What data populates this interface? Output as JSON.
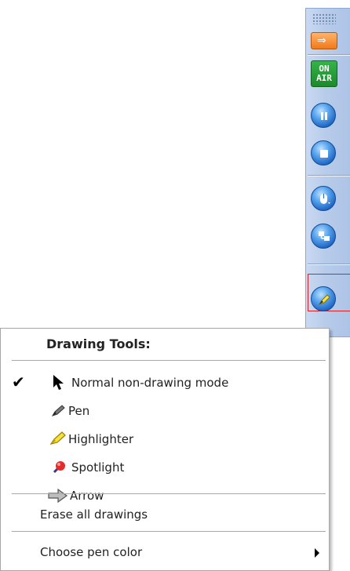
{
  "toolbar": {
    "onair_line1": "ON",
    "onair_line2": "AIR",
    "arrow_glyph": "⇒"
  },
  "menu": {
    "title": "Drawing Tools:",
    "items": [
      {
        "label": "Normal non-drawing mode",
        "checked": true,
        "icon": "cursor-icon"
      },
      {
        "label": "Pen",
        "icon": "pen-icon"
      },
      {
        "label": "Highlighter",
        "icon": "highlighter-icon"
      },
      {
        "label": "Spotlight",
        "icon": "spotlight-icon"
      },
      {
        "label": "Arrow",
        "icon": "arrow-icon"
      }
    ],
    "erase_label": "Erase all drawings",
    "choose_color_label": "Choose pen color",
    "check_mark": "✔"
  },
  "colors": {
    "toolbar_bg": "#b7cbea",
    "onair_green": "#1b8a2b",
    "arrow_orange": "#f07a19",
    "button_blue": "#1f66c4",
    "highlight_border": "#e02020"
  }
}
